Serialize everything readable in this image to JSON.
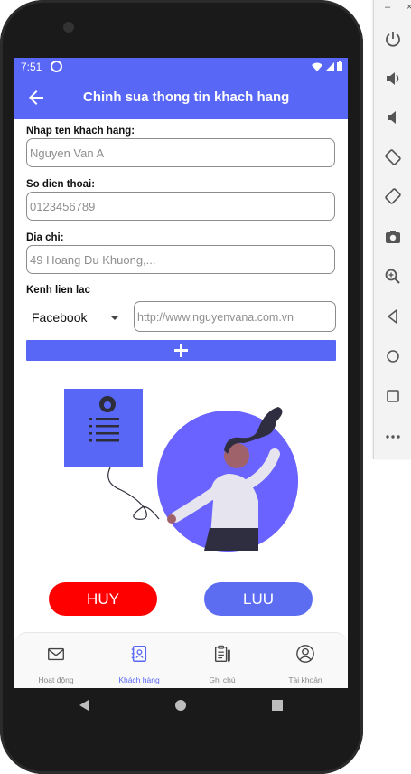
{
  "status_bar": {
    "time": "7:51"
  },
  "app_bar": {
    "title": "Chinh sua thong tin khach hang",
    "back_icon": "arrow-back-icon"
  },
  "form": {
    "name": {
      "label": "Nhap ten khach hang:",
      "value": "Nguyen Van A"
    },
    "phone": {
      "label": "So dien thoai:",
      "value": "0123456789"
    },
    "address": {
      "label": "Dia chi:",
      "value": "49 Hoang Du Khuong,..."
    },
    "contact": {
      "label": "Kenh lien lac",
      "channel": "Facebook",
      "url_placeholder": "http://www.nguyenvana.com.vn"
    },
    "add_icon": "plus-icon"
  },
  "buttons": {
    "cancel": "HUY",
    "save": "LUU"
  },
  "bottom_nav": [
    {
      "label": "Hoat động",
      "icon": "mail-icon",
      "active": false
    },
    {
      "label": "Khách hàng",
      "icon": "contact-book-icon",
      "active": true
    },
    {
      "label": "Ghi chú",
      "icon": "clipboard-icon",
      "active": false
    },
    {
      "label": "Tài khoản",
      "icon": "user-icon",
      "active": false
    }
  ],
  "colors": {
    "primary": "#5867f5",
    "cancel": "#ff0000",
    "save": "#5c6df2"
  }
}
